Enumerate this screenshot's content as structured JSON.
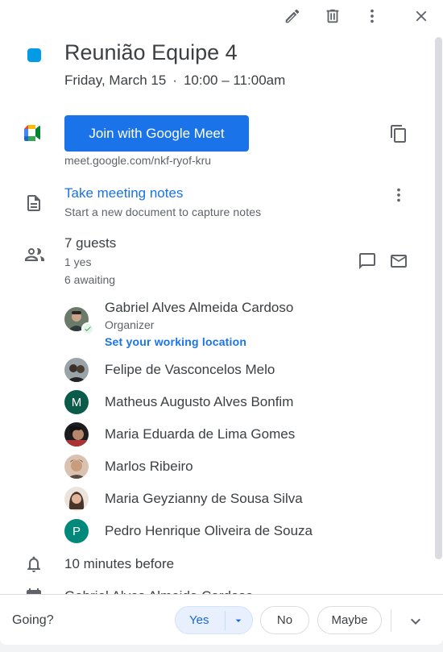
{
  "event": {
    "title": "Reunião Equipe 4",
    "date": "Friday, March 15",
    "separator": "·",
    "time": "10:00 – 11:00am",
    "color": "#039be5"
  },
  "toolbar": {
    "icons": [
      "edit-icon",
      "delete-icon",
      "more-options-icon",
      "close-icon"
    ]
  },
  "meet": {
    "join_label": "Join with Google Meet",
    "link": "meet.google.com/nkf-ryof-kru",
    "button_color": "#1a73e8"
  },
  "notes": {
    "link_label": "Take meeting notes",
    "subtitle": "Start a new document to capture notes"
  },
  "guests": {
    "count_label": "7 guests",
    "yes_label": "1 yes",
    "awaiting_label": "6 awaiting",
    "organizer_role": "Organizer",
    "working_location_label": "Set your working location",
    "list": [
      {
        "name": "Gabriel Alves Almeida Cardoso",
        "avatar": "photo",
        "accepted": true
      },
      {
        "name": "Felipe de Vasconcelos Melo",
        "avatar": "photo"
      },
      {
        "name": "Matheus Augusto Alves Bonfim",
        "avatar": "M",
        "avatar_color": "#0b5b4a"
      },
      {
        "name": "Maria Eduarda de Lima Gomes",
        "avatar": "photo"
      },
      {
        "name": "Marlos Ribeiro",
        "avatar": "photo"
      },
      {
        "name": "Maria Geyzianny de Sousa Silva",
        "avatar": "photo"
      },
      {
        "name": "Pedro Henrique Oliveira de Souza",
        "avatar": "P",
        "avatar_color": "#00897b"
      }
    ]
  },
  "reminder": {
    "label": "10 minutes before"
  },
  "calendar": {
    "owner": "Gabriel Alves Almeida Cardoso"
  },
  "rsvp": {
    "going_label": "Going?",
    "yes_label": "Yes",
    "no_label": "No",
    "maybe_label": "Maybe",
    "selected": "Yes"
  }
}
